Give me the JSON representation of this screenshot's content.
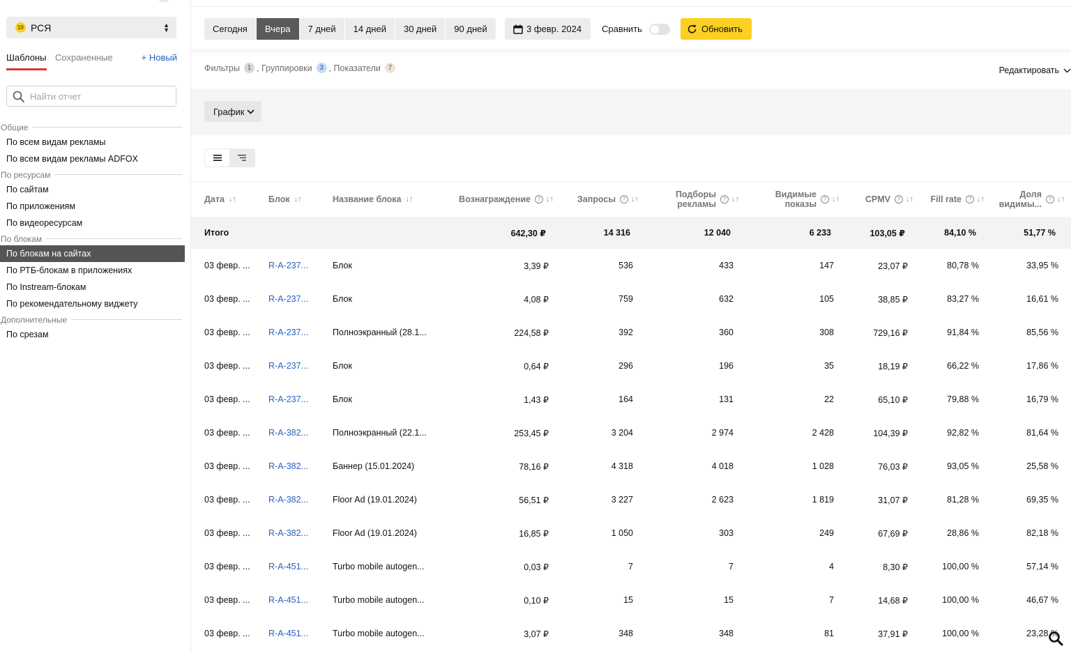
{
  "sidebar": {
    "service_badge": "10",
    "service_name": "РСЯ",
    "tabs": {
      "templates": "Шаблоны",
      "saved": "Сохраненные",
      "new": "+ Новый"
    },
    "search_placeholder": "Найти отчет",
    "groups": [
      {
        "label": "Общие",
        "items": [
          "По всем видам рекламы",
          "По всем видам рекламы ADFOX"
        ]
      },
      {
        "label": "По ресурсам",
        "items": [
          "По сайтам",
          "По приложениям",
          "По видеоресурсам"
        ]
      },
      {
        "label": "По блокам",
        "items": [
          "По блокам на сайтах",
          "По РТБ-блокам в приложениях",
          "По Instream-блокам",
          "По рекомендательному виджету"
        ]
      },
      {
        "label": "Дополнительные",
        "items": [
          "По срезам"
        ]
      }
    ],
    "active_item": "По блокам на сайтах"
  },
  "toolbar": {
    "periods": [
      "Сегодня",
      "Вчера",
      "7 дней",
      "14 дней",
      "30 дней",
      "90 дней"
    ],
    "active_period": "Вчера",
    "date": "3 февр. 2024",
    "compare_label": "Сравнить",
    "compare_on": false,
    "refresh_label": "Обновить",
    "accent_color": "#fcd022"
  },
  "filters": {
    "filters_label": "Фильтры",
    "filters_count": "1",
    "groupings_label": "Группировки",
    "groupings_count": "3",
    "metrics_label": "Показатели",
    "metrics_count": "7",
    "edit_label": "Редактировать"
  },
  "chart": {
    "graph_label": "График"
  },
  "table": {
    "headers": {
      "date": "Дата",
      "block": "Блок",
      "block_name": "Название блока",
      "reward": "Вознаграждение",
      "requests": "Запросы",
      "ad_picks_1": "Подборы",
      "ad_picks_2": "рекламы",
      "visible_1": "Видимые",
      "visible_2": "показы",
      "cpmv": "CPMV",
      "fill_rate": "Fill rate",
      "share_1": "Доля",
      "share_2": "видимы..."
    },
    "total": {
      "label": "Итого",
      "reward": "642,30 ₽",
      "requests": "14 316",
      "ad_picks": "12 040",
      "visible": "6 233",
      "cpmv": "103,05 ₽",
      "fill_rate": "84,10 %",
      "share": "51,77 %"
    },
    "rows": [
      {
        "date": "03 февр. ...",
        "block": "R-A-237...",
        "name": "Блок",
        "reward": "3,39 ₽",
        "requests": "536",
        "ad_picks": "433",
        "visible": "147",
        "cpmv": "23,07 ₽",
        "fill_rate": "80,78 %",
        "share": "33,95 %"
      },
      {
        "date": "03 февр. ...",
        "block": "R-A-237...",
        "name": "Блок",
        "reward": "4,08 ₽",
        "requests": "759",
        "ad_picks": "632",
        "visible": "105",
        "cpmv": "38,85 ₽",
        "fill_rate": "83,27 %",
        "share": "16,61 %"
      },
      {
        "date": "03 февр. ...",
        "block": "R-A-237...",
        "name": "Полноэкранный (28.1...",
        "reward": "224,58 ₽",
        "requests": "392",
        "ad_picks": "360",
        "visible": "308",
        "cpmv": "729,16 ₽",
        "fill_rate": "91,84 %",
        "share": "85,56 %"
      },
      {
        "date": "03 февр. ...",
        "block": "R-A-237...",
        "name": "Блок",
        "reward": "0,64 ₽",
        "requests": "296",
        "ad_picks": "196",
        "visible": "35",
        "cpmv": "18,19 ₽",
        "fill_rate": "66,22 %",
        "share": "17,86 %"
      },
      {
        "date": "03 февр. ...",
        "block": "R-A-237...",
        "name": "Блок",
        "reward": "1,43 ₽",
        "requests": "164",
        "ad_picks": "131",
        "visible": "22",
        "cpmv": "65,10 ₽",
        "fill_rate": "79,88 %",
        "share": "16,79 %"
      },
      {
        "date": "03 февр. ...",
        "block": "R-A-382...",
        "name": "Полноэкранный (22.1...",
        "reward": "253,45 ₽",
        "requests": "3 204",
        "ad_picks": "2 974",
        "visible": "2 428",
        "cpmv": "104,39 ₽",
        "fill_rate": "92,82 %",
        "share": "81,64 %"
      },
      {
        "date": "03 февр. ...",
        "block": "R-A-382...",
        "name": "Баннер (15.01.2024)",
        "reward": "78,16 ₽",
        "requests": "4 318",
        "ad_picks": "4 018",
        "visible": "1 028",
        "cpmv": "76,03 ₽",
        "fill_rate": "93,05 %",
        "share": "25,58 %"
      },
      {
        "date": "03 февр. ...",
        "block": "R-A-382...",
        "name": "Floor Ad (19.01.2024)",
        "reward": "56,51 ₽",
        "requests": "3 227",
        "ad_picks": "2 623",
        "visible": "1 819",
        "cpmv": "31,07 ₽",
        "fill_rate": "81,28 %",
        "share": "69,35 %"
      },
      {
        "date": "03 февр. ...",
        "block": "R-A-382...",
        "name": "Floor Ad (19.01.2024)",
        "reward": "16,85 ₽",
        "requests": "1 050",
        "ad_picks": "303",
        "visible": "249",
        "cpmv": "67,69 ₽",
        "fill_rate": "28,86 %",
        "share": "82,18 %"
      },
      {
        "date": "03 февр. ...",
        "block": "R-A-451...",
        "name": "Turbo mobile autogen...",
        "reward": "0,03 ₽",
        "requests": "7",
        "ad_picks": "7",
        "visible": "4",
        "cpmv": "8,30 ₽",
        "fill_rate": "100,00 %",
        "share": "57,14 %"
      },
      {
        "date": "03 февр. ...",
        "block": "R-A-451...",
        "name": "Turbo mobile autogen...",
        "reward": "0,10 ₽",
        "requests": "15",
        "ad_picks": "15",
        "visible": "7",
        "cpmv": "14,68 ₽",
        "fill_rate": "100,00 %",
        "share": "46,67 %"
      },
      {
        "date": "03 февр. ...",
        "block": "R-A-451...",
        "name": "Turbo mobile autogen...",
        "reward": "3,07 ₽",
        "requests": "348",
        "ad_picks": "348",
        "visible": "81",
        "cpmv": "37,91 ₽",
        "fill_rate": "100,00 %",
        "share": "23,28 %"
      }
    ]
  },
  "icons": {
    "service": "coin-badge-icon",
    "select": "up-down-arrows-icon",
    "search": "search-icon",
    "calendar": "calendar-icon",
    "refresh": "refresh-icon",
    "chevron": "chevron-down-icon",
    "list_view": "list-view-icon",
    "tree_view": "tree-view-icon",
    "help": "question-circle-icon",
    "sort": "sort-arrows-icon",
    "zoom": "magnifier-icon"
  }
}
